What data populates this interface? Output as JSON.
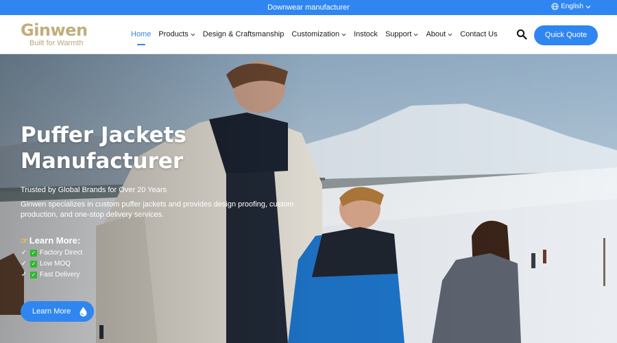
{
  "topbar": {
    "announcement": "Downwear manufacturer",
    "language": "English"
  },
  "header": {
    "logo_brand": "Ginwen",
    "logo_tagline": "Built for Warmth",
    "nav": [
      {
        "label": "Home",
        "active": true,
        "dropdown": false
      },
      {
        "label": "Products",
        "active": false,
        "dropdown": true
      },
      {
        "label": "Design & Craftsmanship",
        "active": false,
        "dropdown": false
      },
      {
        "label": "Customization",
        "active": false,
        "dropdown": true
      },
      {
        "label": "Instock",
        "active": false,
        "dropdown": false
      },
      {
        "label": "Support",
        "active": false,
        "dropdown": true
      },
      {
        "label": "About",
        "active": false,
        "dropdown": true
      },
      {
        "label": "Contact Us",
        "active": false,
        "dropdown": false
      }
    ],
    "quote_button": "Quick Quote"
  },
  "hero": {
    "title_line1": "Puffer Jackets",
    "title_line2": "Manufacturer",
    "subtitle": "Trusted by Global Brands for Over 20 Years",
    "description": "Ginwen specializes in custom puffer jackets and provides design proofing, custom production, and one-stop delivery services.",
    "learn_heading": "Learn More:",
    "features": [
      "Factory Direct",
      "Low MOQ",
      "Fast Delivery"
    ],
    "button_label": "Learn More"
  },
  "colors": {
    "primary": "#2f86f0",
    "brand_gold": "#c3ad7c",
    "check_green": "#2eb82e"
  }
}
